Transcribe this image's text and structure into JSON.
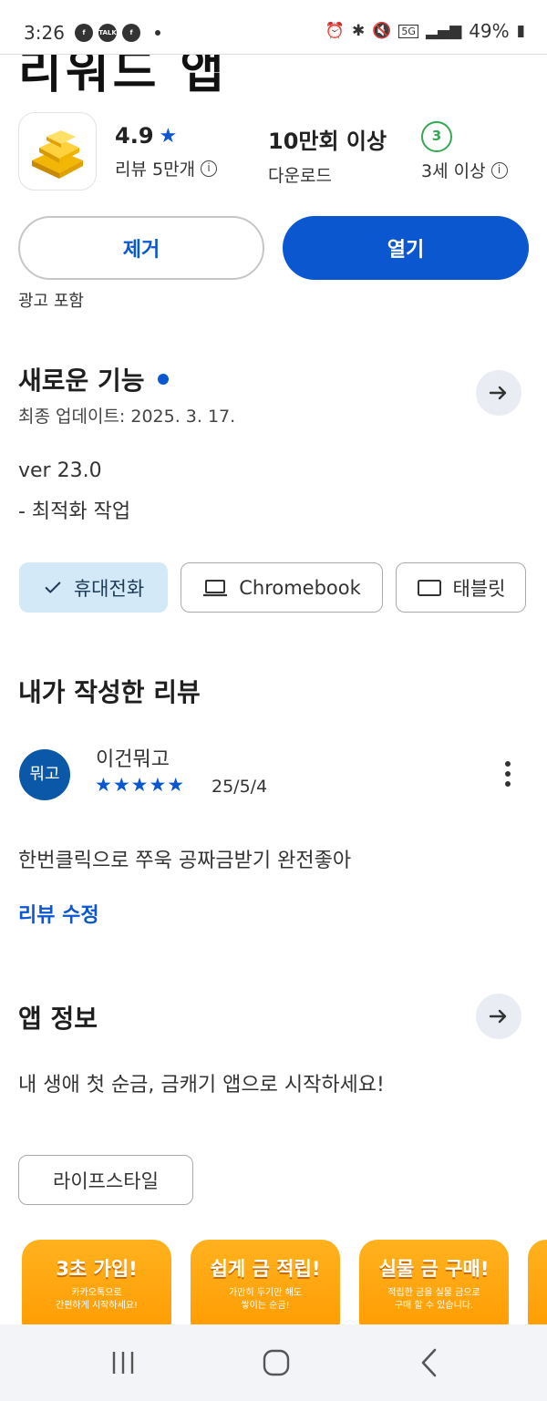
{
  "status": {
    "time": "3:26",
    "battery": "49%",
    "network": "5G",
    "notif_talk": "TALK"
  },
  "header": {
    "title_partial": "리워드 앱"
  },
  "stats": {
    "rating_value": "4.9",
    "rating_label": "리뷰 5만개",
    "downloads_value": "10만회 이상",
    "downloads_label": "다운로드",
    "age_badge": "3",
    "age_label": "3세 이상"
  },
  "actions": {
    "remove_label": "제거",
    "open_label": "열기",
    "ads_note": "광고 포함"
  },
  "whats_new": {
    "title": "새로운 기능",
    "updated": "최종 업데이트: 2025. 3. 17.",
    "version": "ver 23.0",
    "note": "- 최적화 작업"
  },
  "devices": {
    "phone": "휴대전화",
    "chromebook": "Chromebook",
    "tablet": "태블릿"
  },
  "my_review": {
    "title": "내가 작성한 리뷰",
    "avatar_text": "뭐고",
    "reviewer": "이건뭐고",
    "stars": "★★★★★",
    "stars_count": 5,
    "date": "25/5/4",
    "text": "한번클릭으로 쭈욱 공짜금받기 완전좋아",
    "edit_link": "리뷰 수정"
  },
  "app_info": {
    "title": "앱 정보",
    "description": "내 생애 첫 순금, 금캐기 앱으로 시작하세요!",
    "category": "라이프스타일"
  },
  "screenshots": [
    {
      "title": "3초 가입!",
      "sub1": "카카오톡으로",
      "sub2": "간편하게 시작하세요!"
    },
    {
      "title": "쉽게 금 적립!",
      "sub1": "가만히 두기만 해도",
      "sub2": "쌓이는 순금!"
    },
    {
      "title": "실물 금 구매!",
      "sub1": "적립한 금을 실물 금으로",
      "sub2": "구매 할 수 있습니다."
    }
  ],
  "colors": {
    "accent": "#0b57d0",
    "chip_selected": "#d3e9f7",
    "age_green": "#34a853",
    "screenshot_orange": "#ff9a00"
  }
}
